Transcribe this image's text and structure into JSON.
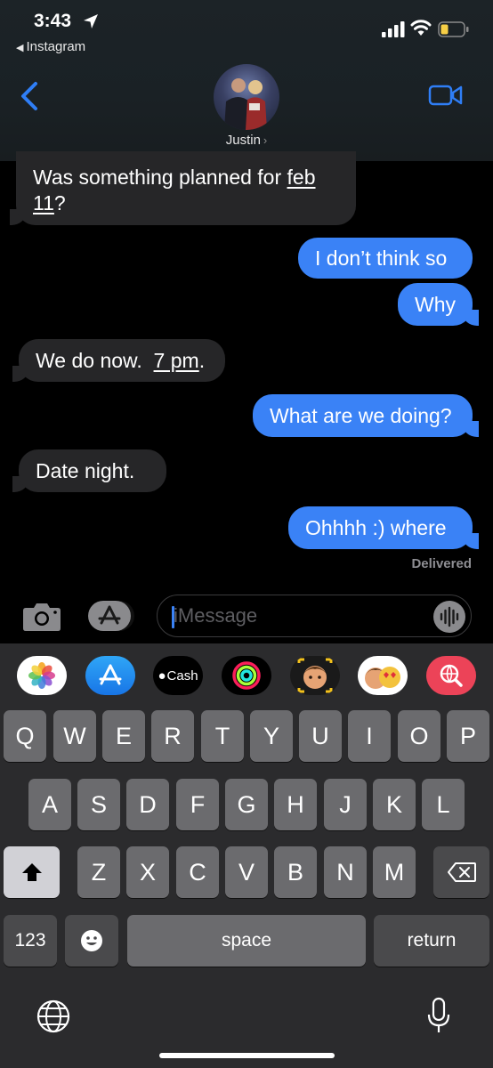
{
  "status_bar": {
    "time": "3:43",
    "back_app": "Instagram"
  },
  "header": {
    "contact_name": "Justin"
  },
  "messages": [
    {
      "side": "received",
      "line1": "Was something planned for ",
      "line1_link": "feb",
      "line2_link": "11",
      "line2_rest": "?"
    },
    {
      "side": "sent",
      "text": "I don’t think so"
    },
    {
      "side": "sent",
      "text": "Why"
    },
    {
      "side": "received",
      "text": "We do now.  ",
      "link": "7 pm",
      "after": "."
    },
    {
      "side": "sent",
      "text": "What are we doing?"
    },
    {
      "side": "received",
      "text": "Date night."
    },
    {
      "side": "sent",
      "text": "Ohhhh :) where"
    }
  ],
  "delivered_label": "Delivered",
  "input": {
    "placeholder": "iMessage"
  },
  "app_drawer": {
    "cash_label": "Cash",
    "apps": [
      "photos-icon",
      "app-store-icon",
      "apple-cash-icon",
      "activity-icon",
      "memoji-icon",
      "memoji-stickers-icon",
      "web-search-icon"
    ]
  },
  "keyboard": {
    "row1": [
      "Q",
      "W",
      "E",
      "R",
      "T",
      "Y",
      "U",
      "I",
      "O",
      "P"
    ],
    "row2": [
      "A",
      "S",
      "D",
      "F",
      "G",
      "H",
      "J",
      "K",
      "L"
    ],
    "row3": [
      "Z",
      "X",
      "C",
      "V",
      "B",
      "N",
      "M"
    ],
    "numbers_label": "123",
    "space_label": "space",
    "return_label": "return"
  },
  "colors": {
    "sent_bubble": "#3a82f6",
    "received_bubble": "#262628",
    "accent": "#2f7ef6"
  }
}
